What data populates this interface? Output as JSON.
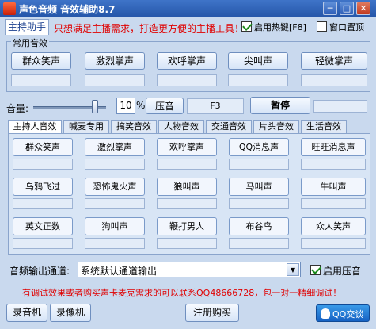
{
  "window": {
    "title": "声色音频 音效辅助8.7"
  },
  "header": {
    "tab_label": "主持助手",
    "promo": "只想满足主播需求，打造更方便的主播工具！",
    "hotkey_label": "启用热键[F8]",
    "pin_label": "窗口置顶",
    "colors": {
      "promo": "#e00000",
      "accent": "#2455a8"
    }
  },
  "common": {
    "group_label": "常用音效",
    "buttons": [
      "群众笑声",
      "激烈掌声",
      "欢呼掌声",
      "尖叫声",
      "轻微掌声"
    ]
  },
  "volume": {
    "label": "音量:",
    "value": "10",
    "unit": "%",
    "level": 0.85,
    "pressure_label": "压音",
    "hotkey": "F3",
    "pause_label": "暂停"
  },
  "tabs": [
    "主持人音效",
    "喊麦专用",
    "搞笑音效",
    "人物音效",
    "交通音效",
    "片头音效",
    "生活音效"
  ],
  "grid": [
    [
      "群众笑声",
      "激烈掌声",
      "欢呼掌声",
      "QQ消息声",
      "旺旺消息声"
    ],
    [
      "乌鸦飞过",
      "恐怖鬼火声",
      "狼叫声",
      "马叫声",
      "牛叫声"
    ],
    [
      "英文正数",
      "狗叫声",
      "鞭打男人",
      "布谷鸟",
      "众人笑声"
    ]
  ],
  "output": {
    "label": "音频输出通道:",
    "value": "系统默认通道输出",
    "compress_label": "启用压音"
  },
  "notice": "有调试效果或者购买声卡麦克需求的可以联系QQ48666728，包一对一精细调试！",
  "footer": {
    "record_audio": "录音机",
    "record_video": "录像机",
    "register": "注册购买",
    "qq_chat": "QQ交谈"
  }
}
